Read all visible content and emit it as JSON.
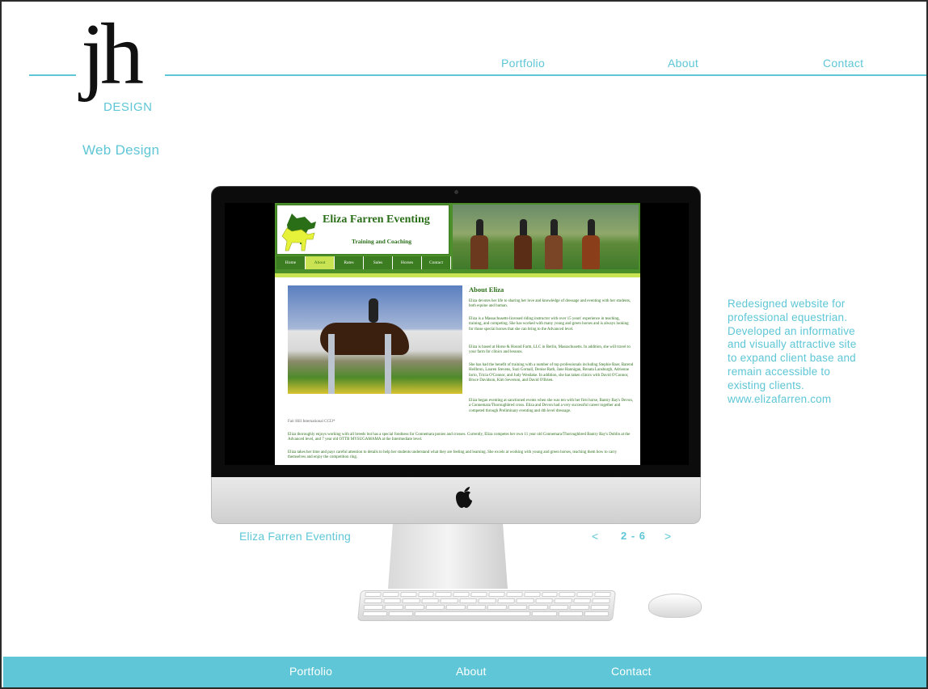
{
  "logo": {
    "mark": "jh",
    "sub": "DESIGN"
  },
  "nav": {
    "portfolio": "Portfolio",
    "about": "About",
    "contact": "Contact"
  },
  "page_title": "Web Design",
  "site_preview": {
    "name": "Eliza Farren Eventing",
    "tagline": "Training and Coaching",
    "menu": [
      "Home",
      "About",
      "Rates",
      "Sales",
      "Horses",
      "Contact"
    ],
    "active_menu": "About",
    "heading": "About Eliza",
    "photo_caption": "Fair Hill International CCI3*",
    "paragraphs": [
      "Eliza devotes her life to sharing her love and knowledge of dressage and eventing with her students, both equine and human.",
      "Eliza is a Massachusetts-licensed riding instructor with over 15 years' experience in teaching, training, and competing. She has worked with many young and green horses and is always looking for those special horses that she can bring to the Advanced level.",
      "Eliza is based at Horse & Hound Farm, LLC in Berlin, Massachusetts. In addition, she will travel to your farm for clinics and lessons.",
      "She has had the benefit of training with a number of top professionals including Stephie Baer, Barend Heilbron, Lauren Stevens, Suzi Gornall, Denise Rath, Jane Hannigan, Renata Lansburgh, Adrienne Iorio, Tricia O'Connor, and Judy Westlake. In addition, she has taken clinics with David O'Connor, Bruce Davidson, Kim Severson, and David O'Brien.",
      "Eliza began eventing at sanctioned events when she was ten with her first horse, Bantry Bay's Devon, a Connemara/Thoroughbred cross. Eliza and Devon had a very successful career together and competed through Preliminary eventing and 4th level dressage.",
      "Eliza thoroughly enjoys working with all breeds but has a special fondness for Connemara ponies and crosses.  Currently, Eliza competes her own 11 year old Connemara/Thoroughbred Bantry Bay's Dublin at the Advanced level, and 7 year old OTTB MYSUGAMAMA at the Intermediate level.",
      "Eliza takes her time and pays careful attention to details to help her students understand what they are feeling and learning. She excels at working with young and green horses, teaching them how to carry themselves and enjoy the competition ring."
    ]
  },
  "description": {
    "lines": [
      "Redesigned website for",
      "professional equestrian.",
      "Developed an informative",
      "and visually attractive site",
      "to expand client base and",
      "remain accessible to",
      "existing clients."
    ],
    "url": "www.elizafarren.com"
  },
  "slide": {
    "name": "Eliza Farren Eventing",
    "prev": "<",
    "count": "2 - 6",
    "next": ">"
  },
  "footer": {
    "portfolio": "Portfolio",
    "about": "About",
    "contact": "Contact"
  },
  "colors": {
    "accent": "#5ec6d6",
    "site_green": "#2a6e18",
    "site_lime": "#c9e352"
  },
  "icons": {
    "monitor_logo": "apple-icon",
    "prev": "chevron-left-icon",
    "next": "chevron-right-icon"
  }
}
